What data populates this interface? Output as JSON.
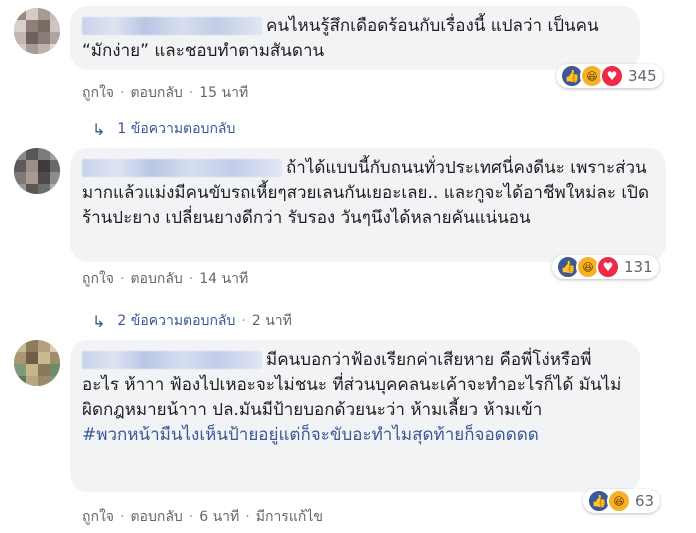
{
  "comments": [
    {
      "text": "คนไหนรู้สึกเดือดร้อนกับเรื่องนี้ แปลว่า เป็นคน “มักง่าย” และชอบทำตามสันดาน",
      "reaction_count": "345",
      "reaction_icons": [
        "like-icon",
        "haha-icon",
        "love-icon"
      ],
      "like": "ถูกใจ",
      "reply": "ตอบกลับ",
      "time": "15 นาที",
      "replies_label": "1 ข้อความตอบกลับ"
    },
    {
      "text": "ถ้าได้แบบนี้กับถนนทั่วประเทศนี่คงดีนะ เพราะส่วนมากแล้วแม่งมีคนขับรถเหี้ยๆสวยเลนกันเยอะเลย.. และกูจะได้อาชีพใหม่ละ เปิดร้านปะยาง เปลี่ยนยางดีกว่า รับรอง วันๆนึงได้หลายคันแน่นอน",
      "reaction_count": "131",
      "reaction_icons": [
        "like-icon",
        "haha-icon",
        "love-icon"
      ],
      "like": "ถูกใจ",
      "reply": "ตอบกลับ",
      "time": "14 นาที",
      "replies_label": "2 ข้อความตอบกลับ",
      "replies_time": "2 นาที"
    },
    {
      "text": "มีคนบอกว่าฟ้องเรียกค่าเสียหาย คือพี่โง่หรือพี่อะไร ห้าาา ฟ้องไปเหอะจะไม่ชนะ ที่ส่วนบุคคลนะเค้าจะทำอะไรก็ได้ มันไม่ผิดกฎหมายน้าาา ปล.มันมีป้ายบอกด้วยนะว่า ห้ามเลี้ยว ห้ามเข้า",
      "hashtag": "#พวกหน้ามืนไงเห็นป้ายอยู่แต่ก็จะขับอะทำไมสุดท้ายก็จอดดดด",
      "reaction_count": "63",
      "reaction_icons": [
        "like-icon",
        "haha-icon"
      ],
      "like": "ถูกใจ",
      "reply": "ตอบกลับ",
      "time": "6 นาที",
      "edited": "มีการแก้ไข"
    }
  ],
  "colors": {
    "bubble": "#f2f3f5",
    "link": "#385898",
    "meta": "#606770",
    "like": "#3b5998",
    "haha": "#f7b125",
    "love": "#f0284a"
  }
}
